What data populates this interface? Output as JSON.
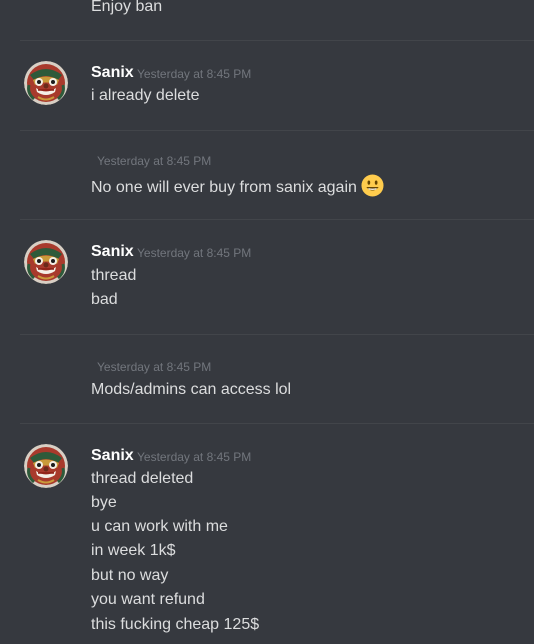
{
  "messages": {
    "m0": {
      "lines": [
        "Enjoy ban"
      ]
    },
    "m1": {
      "author": "Sanix",
      "timestamp": "Yesterday at 8:45 PM",
      "lines": [
        "i already delete"
      ]
    },
    "m2": {
      "timestamp": "Yesterday at 8:45 PM",
      "lines": [
        "No one will ever buy from sanix again"
      ],
      "emoji": "smiley-emoji"
    },
    "m3": {
      "author": "Sanix",
      "timestamp": "Yesterday at 8:45 PM",
      "lines": [
        "thread",
        "bad"
      ]
    },
    "m4": {
      "timestamp": "Yesterday at 8:45 PM",
      "lines": [
        "Mods/admins can access lol"
      ]
    },
    "m5": {
      "author": "Sanix",
      "timestamp": "Yesterday at 8:45 PM",
      "lines": [
        "thread deleted",
        "bye",
        "u can work with me",
        "in week 1k$",
        "but no way",
        "you want refund",
        "this fucking cheap 125$"
      ]
    }
  },
  "colors": {
    "background": "#36393f",
    "text": "#dcddde",
    "author": "#ffffff",
    "timestamp": "#72767d",
    "divider": "#42454a"
  }
}
